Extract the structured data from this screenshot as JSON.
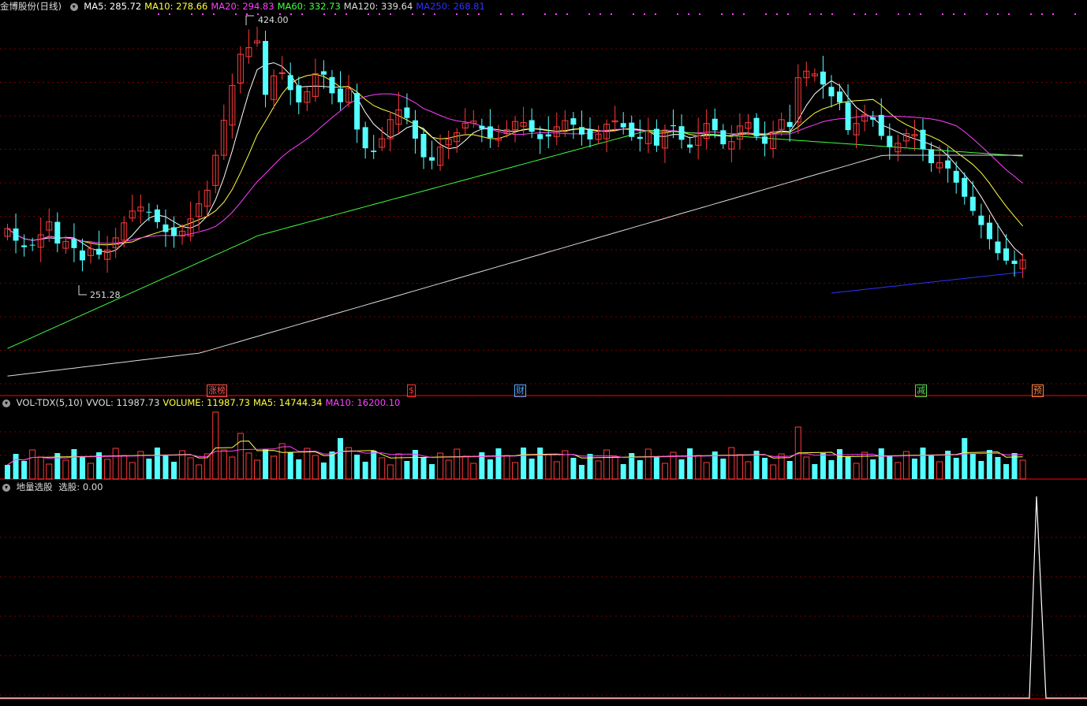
{
  "header": {
    "title": "金博股份(日线)",
    "ma_labels": [
      {
        "text": "MA5: 285.72",
        "color": "#ffffff"
      },
      {
        "text": "MA10: 278.66",
        "color": "#ffff40"
      },
      {
        "text": "MA20: 294.83",
        "color": "#ff40ff"
      },
      {
        "text": "MA60: 332.73",
        "color": "#40ff40"
      },
      {
        "text": "MA120: 339.64",
        "color": "#dddddd"
      },
      {
        "text": "MA250: 268.81",
        "color": "#3030ff"
      }
    ]
  },
  "price_panel": {
    "high_label": "424.00",
    "low_label": "251.28",
    "event_markers": [
      {
        "text": "涨榜",
        "color": "#ff5555"
      },
      {
        "text": "$",
        "color": "#ff3333"
      },
      {
        "text": "财",
        "color": "#55aaff"
      },
      {
        "text": "减",
        "color": "#55dd55"
      },
      {
        "text": "预",
        "color": "#ff8844"
      }
    ]
  },
  "volume_panel": {
    "labels": [
      {
        "text": "VOL-TDX(5,10)",
        "color": "#dddddd"
      },
      {
        "text": "VVOL: 11987.73",
        "color": "#dddddd"
      },
      {
        "text": "VOLUME: 11987.73",
        "color": "#ffff40"
      },
      {
        "text": "MA5: 14744.34",
        "color": "#ffff40"
      },
      {
        "text": "MA10: 16200.10",
        "color": "#ff40ff"
      }
    ]
  },
  "indicator_panel": {
    "title": "地量选股",
    "value_label": "选股: 0.00"
  },
  "colors": {
    "up": "#ff3b3b",
    "down": "#54ffff",
    "grid": "#7a0000",
    "border": "#b00000"
  }
}
